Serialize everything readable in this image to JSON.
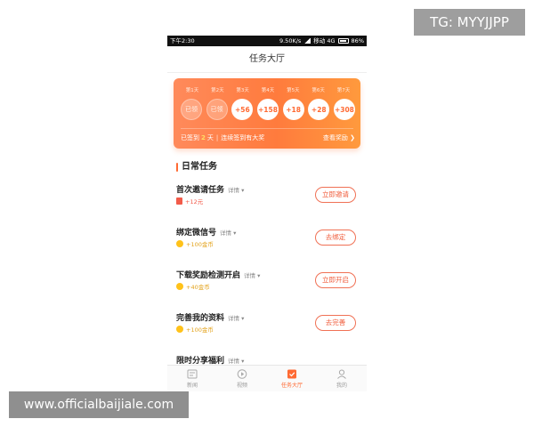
{
  "watermarks": {
    "top_right": "TG: MYYJJPP",
    "bottom_left": "www.officialbaijiale.com"
  },
  "status_bar": {
    "time": "下午2:30",
    "network_speed": "9.50K/s",
    "carrier": "移动 4G",
    "battery": "86%"
  },
  "header": {
    "title": "任务大厅"
  },
  "checkin": {
    "days": [
      {
        "label": "第1天",
        "value": "已领",
        "state": "claimed"
      },
      {
        "label": "第2天",
        "value": "已领",
        "state": "claimed"
      },
      {
        "label": "第3天",
        "value": "+56",
        "state": "open"
      },
      {
        "label": "第4天",
        "value": "+158",
        "state": "open"
      },
      {
        "label": "第5天",
        "value": "+18",
        "state": "open"
      },
      {
        "label": "第6天",
        "value": "+28",
        "state": "open"
      },
      {
        "label": "第7天",
        "value": "+308",
        "state": "open"
      }
    ],
    "streak_prefix": "已签到",
    "streak_days": "2",
    "streak_unit": "天",
    "separator": "|",
    "streak_bonus_text": "连续签到有大奖",
    "view_reward": "查看奖励 ❯"
  },
  "daily": {
    "section_title": "日常任务",
    "tasks": [
      {
        "name": "首次邀请任务",
        "detail": "详情 ▾",
        "reward": "+12元",
        "reward_kind": "cash",
        "button": "立即邀请"
      },
      {
        "name": "绑定微信号",
        "detail": "详情 ▾",
        "reward": "+100金币",
        "reward_kind": "gold",
        "button": "去绑定"
      },
      {
        "name": "下载奖励检测开启",
        "detail": "详情 ▾",
        "reward": "+40金币",
        "reward_kind": "gold",
        "button": "立即开启"
      },
      {
        "name": "完善我的资料",
        "detail": "详情 ▾",
        "reward": "+100金币",
        "reward_kind": "gold",
        "button": "去完善"
      },
      {
        "name": "限时分享福利",
        "detail": "详情 ▾"
      }
    ]
  },
  "tab_bar": {
    "tabs": [
      {
        "label": "新闻",
        "icon": "news-icon"
      },
      {
        "label": "视频",
        "icon": "video-play-icon"
      },
      {
        "label": "任务大厅",
        "icon": "task-hall-icon",
        "active": true
      },
      {
        "label": "我的",
        "icon": "profile-icon"
      }
    ]
  },
  "colors": {
    "accent": "#ff6a33",
    "card_gradient_start": "#ff8a5b",
    "card_gradient_end": "#ff9a3d",
    "button_border": "#f07155",
    "gold": "#ffc21a"
  }
}
